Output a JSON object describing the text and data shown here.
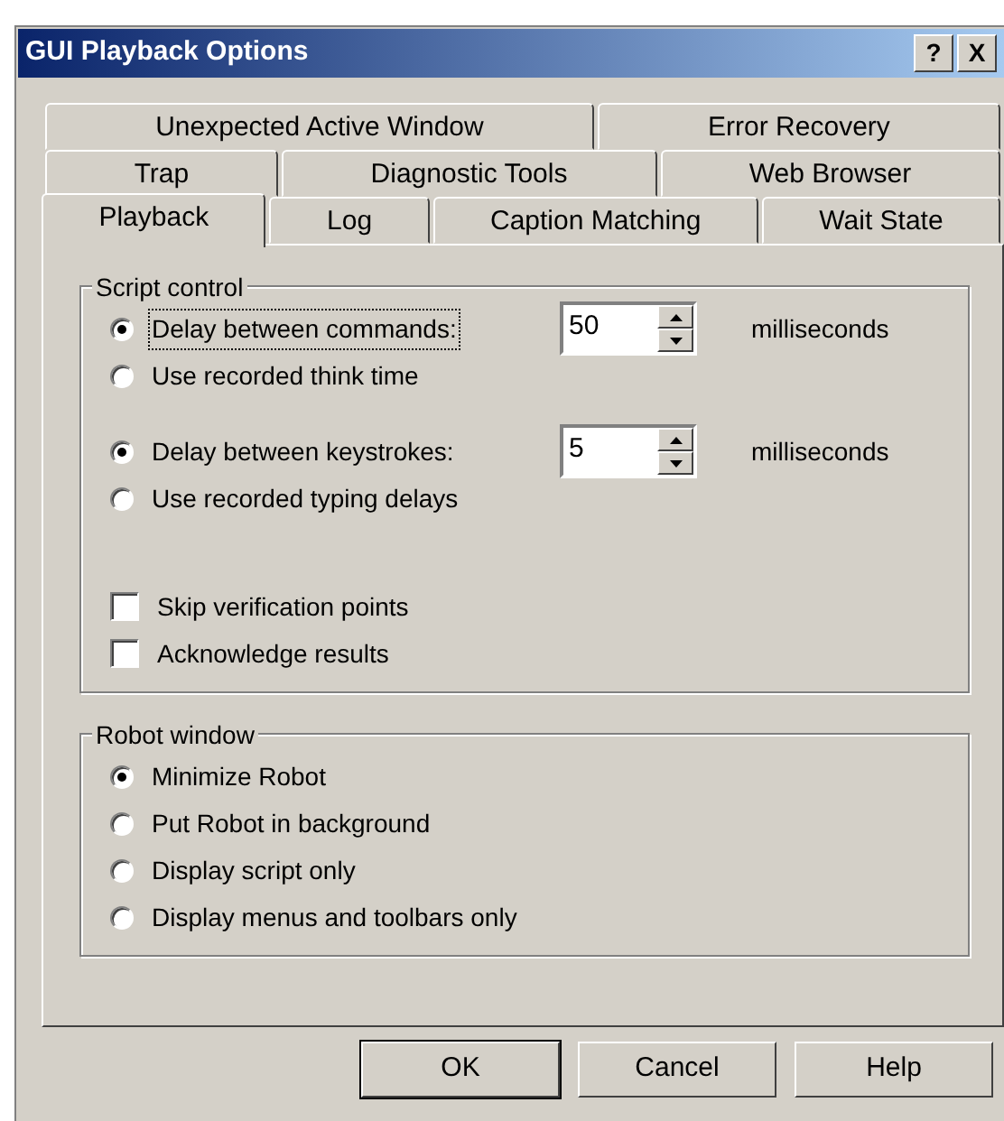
{
  "window": {
    "title": "GUI Playback Options",
    "title_buttons": [
      "?",
      "X"
    ]
  },
  "tab_rows": [
    {
      "tabs": [
        {
          "label": "Unexpected Active Window",
          "selected": false
        },
        {
          "label": "Error Recovery",
          "selected": false
        }
      ]
    },
    {
      "tabs": [
        {
          "label": "Trap",
          "selected": false
        },
        {
          "label": "Diagnostic Tools",
          "selected": false
        },
        {
          "label": "Web Browser",
          "selected": false
        }
      ]
    },
    {
      "tabs": [
        {
          "label": "Playback",
          "selected": true
        },
        {
          "label": "Log",
          "selected": false
        },
        {
          "label": "Caption Matching",
          "selected": false
        },
        {
          "label": "Wait State",
          "selected": false
        }
      ]
    }
  ],
  "script_control": {
    "title": "Script control",
    "groups": [
      {
        "items": [
          {
            "kind": "radio",
            "label": "Delay between commands:",
            "selected": true,
            "focused": true,
            "spin_value": "50",
            "unit": "milliseconds"
          },
          {
            "kind": "radio",
            "label": "Use recorded think time",
            "selected": false,
            "focused": false
          }
        ]
      },
      {
        "items": [
          {
            "kind": "radio",
            "label": "Delay between keystrokes:",
            "selected": true,
            "focused": false,
            "spin_value": "5",
            "unit": "milliseconds"
          },
          {
            "kind": "radio",
            "label": "Use recorded typing delays",
            "selected": false,
            "focused": false
          }
        ]
      },
      {
        "items": [
          {
            "kind": "checkbox",
            "label": "Skip verification points",
            "checked": false,
            "focused": false
          },
          {
            "kind": "checkbox",
            "label": "Acknowledge results",
            "checked": false,
            "focused": false
          }
        ]
      }
    ]
  },
  "robot_window": {
    "title": "Robot window",
    "items": [
      {
        "kind": "radio",
        "label": "Minimize Robot",
        "selected": true
      },
      {
        "kind": "radio",
        "label": "Put Robot in background",
        "selected": false
      },
      {
        "kind": "radio",
        "label": "Display script only",
        "selected": false
      },
      {
        "kind": "radio",
        "label": "Display menus and toolbars only",
        "selected": false
      }
    ]
  },
  "buttons": [
    {
      "label": "OK",
      "default": true
    },
    {
      "label": "Cancel",
      "default": false
    },
    {
      "label": "Help",
      "default": false
    }
  ]
}
